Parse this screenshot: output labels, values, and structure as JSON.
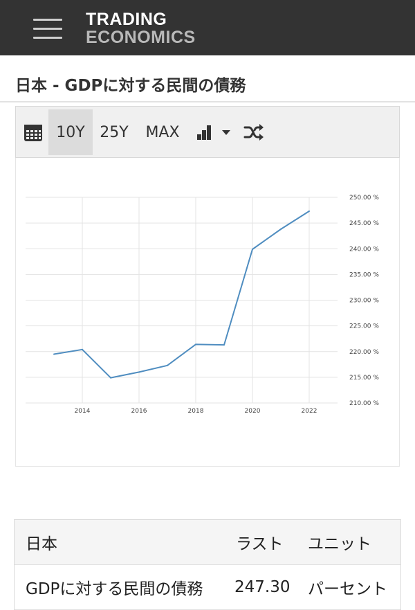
{
  "header": {
    "logo_line1": "TRADING",
    "logo_line2": "ECONOMICS"
  },
  "page": {
    "title": "日本 - GDPに対する民間の債務"
  },
  "toolbar": {
    "range_10y": "10Y",
    "range_25y": "25Y",
    "range_max": "MAX",
    "active_range": "10Y"
  },
  "chart_data": {
    "type": "line",
    "title": "",
    "xlabel": "",
    "ylabel": "",
    "x_ticks": [
      "2014",
      "2016",
      "2018",
      "2020",
      "2022"
    ],
    "y_ticks": [
      "210.00 %",
      "215.00 %",
      "220.00 %",
      "225.00 %",
      "230.00 %",
      "235.00 %",
      "240.00 %",
      "245.00 %",
      "250.00 %"
    ],
    "ylim": [
      210,
      250
    ],
    "xlim": [
      2012.0,
      2023.0
    ],
    "grid": true,
    "series": [
      {
        "color": "#4f8dc0",
        "x": [
          2013,
          2014,
          2015,
          2016,
          2017,
          2018,
          2019,
          2020,
          2021,
          2022
        ],
        "values": [
          219.5,
          220.4,
          214.9,
          216.0,
          217.3,
          221.4,
          221.3,
          239.9,
          243.8,
          247.3
        ]
      }
    ]
  },
  "table": {
    "headers": [
      "日本",
      "ラスト",
      "ユニット"
    ],
    "rows": [
      [
        "GDPに対する民間の債務",
        "247.30",
        "パーセント"
      ]
    ]
  }
}
